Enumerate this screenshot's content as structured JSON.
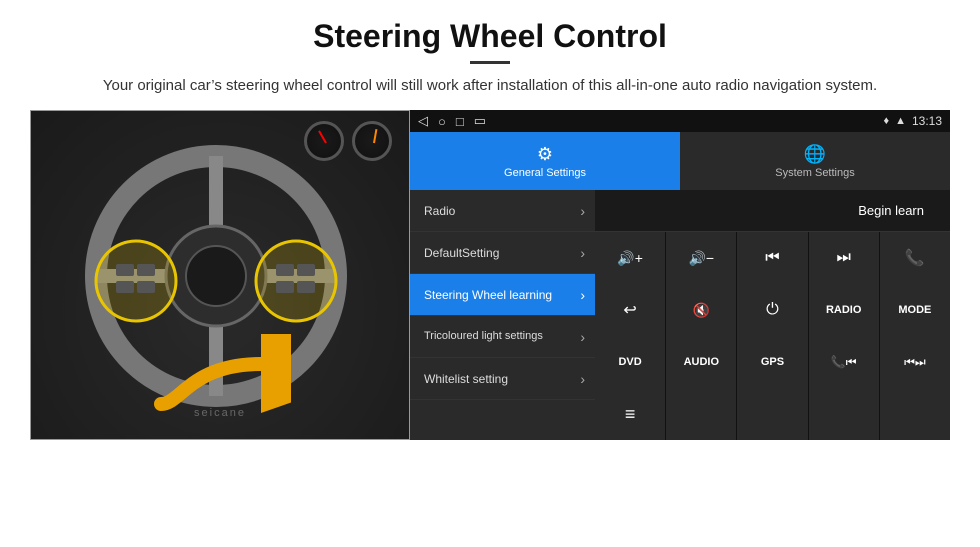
{
  "header": {
    "title": "Steering Wheel Control",
    "subtitle": "Your original car’s steering wheel control will still work after installation of this all-in-one auto radio navigation system."
  },
  "status_bar": {
    "time": "13:13",
    "nav_icons": [
      "◁",
      "○",
      "□",
      "▭"
    ]
  },
  "tabs": [
    {
      "label": "General Settings",
      "active": true
    },
    {
      "label": "System Settings",
      "active": false
    }
  ],
  "menu_items": [
    {
      "label": "Radio",
      "active": false
    },
    {
      "label": "DefaultSetting",
      "active": false
    },
    {
      "label": "Steering Wheel learning",
      "active": true
    },
    {
      "label": "Tricoloured light settings",
      "active": false
    },
    {
      "label": "Whitelist setting",
      "active": false
    }
  ],
  "begin_learn_btn": "Begin learn",
  "control_buttons_row1": [
    {
      "icon": "🔇+",
      "label": "vol-up"
    },
    {
      "icon": "🔇−",
      "label": "vol-down"
    },
    {
      "icon": "⏮",
      "label": "prev"
    },
    {
      "icon": "⏭",
      "label": "next"
    },
    {
      "icon": "📞",
      "label": "call"
    }
  ],
  "control_buttons_row2": [
    {
      "icon": "↩",
      "label": "back"
    },
    {
      "icon": "🔇×",
      "label": "mute"
    },
    {
      "icon": "⏻",
      "label": "power"
    },
    {
      "text": "RADIO",
      "label": "radio"
    },
    {
      "text": "MODE",
      "label": "mode"
    }
  ],
  "control_buttons_row3": [
    {
      "text": "DVD",
      "label": "dvd"
    },
    {
      "text": "AUDIO",
      "label": "audio"
    },
    {
      "text": "GPS",
      "label": "gps"
    },
    {
      "icon": "📞⏮",
      "label": "phone-prev"
    },
    {
      "icon": "⏮⏭",
      "label": "phone-next"
    }
  ],
  "control_buttons_row4": [
    {
      "icon": "≡",
      "label": "menu"
    }
  ]
}
